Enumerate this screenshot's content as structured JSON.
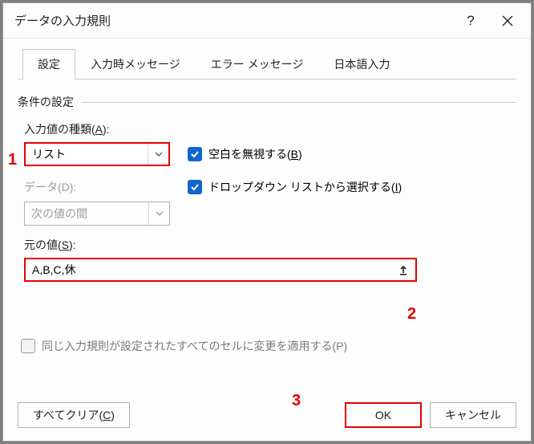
{
  "title": "データの入力規則",
  "tabs": {
    "settings": "設定",
    "input_msg": "入力時メッセージ",
    "error_msg": "エラー メッセージ",
    "ime": "日本語入力"
  },
  "group": {
    "label": "条件の設定"
  },
  "allow": {
    "label_pre": "入力値の種類(",
    "label_key": "A",
    "label_post": "):",
    "value": "リスト"
  },
  "ignore_blank": {
    "pre": "空白を無視する(",
    "key": "B",
    "post": ")"
  },
  "dropdown_sel": {
    "pre": "ドロップダウン リストから選択する(",
    "key": "I",
    "post": ")"
  },
  "data": {
    "label": "データ(D):",
    "value": "次の値の間"
  },
  "source": {
    "label_pre": "元の値(",
    "label_key": "S",
    "label_post": "):",
    "value": "A,B,C,休"
  },
  "apply_all": "同じ入力規則が設定されたすべてのセルに変更を適用する(P)",
  "buttons": {
    "clear_all_pre": "すべてクリア(",
    "clear_all_key": "C",
    "clear_all_post": ")",
    "ok": "OK",
    "cancel": "キャンセル"
  },
  "annotations": {
    "one": "1",
    "two": "2",
    "three": "3"
  }
}
